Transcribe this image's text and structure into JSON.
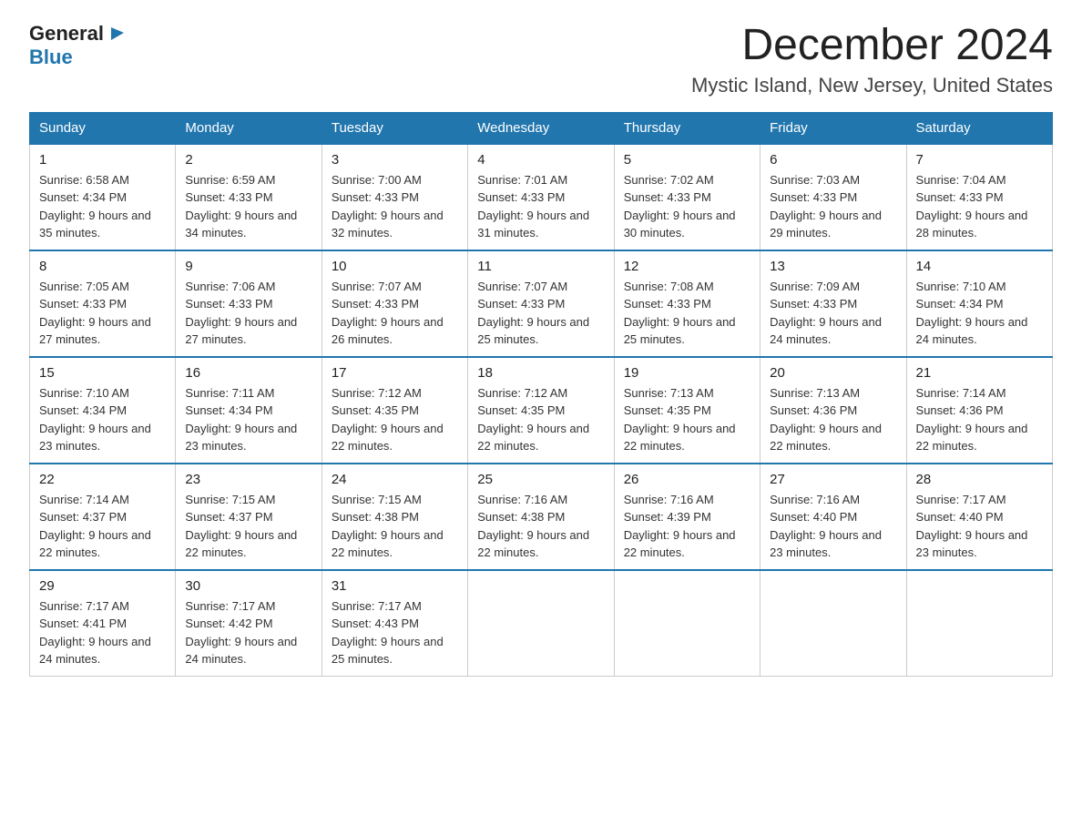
{
  "logo": {
    "general": "General",
    "blue": "Blue"
  },
  "title": "December 2024",
  "subtitle": "Mystic Island, New Jersey, United States",
  "days_of_week": [
    "Sunday",
    "Monday",
    "Tuesday",
    "Wednesday",
    "Thursday",
    "Friday",
    "Saturday"
  ],
  "weeks": [
    [
      {
        "day": "1",
        "sunrise": "6:58 AM",
        "sunset": "4:34 PM",
        "daylight": "9 hours and 35 minutes."
      },
      {
        "day": "2",
        "sunrise": "6:59 AM",
        "sunset": "4:33 PM",
        "daylight": "9 hours and 34 minutes."
      },
      {
        "day": "3",
        "sunrise": "7:00 AM",
        "sunset": "4:33 PM",
        "daylight": "9 hours and 32 minutes."
      },
      {
        "day": "4",
        "sunrise": "7:01 AM",
        "sunset": "4:33 PM",
        "daylight": "9 hours and 31 minutes."
      },
      {
        "day": "5",
        "sunrise": "7:02 AM",
        "sunset": "4:33 PM",
        "daylight": "9 hours and 30 minutes."
      },
      {
        "day": "6",
        "sunrise": "7:03 AM",
        "sunset": "4:33 PM",
        "daylight": "9 hours and 29 minutes."
      },
      {
        "day": "7",
        "sunrise": "7:04 AM",
        "sunset": "4:33 PM",
        "daylight": "9 hours and 28 minutes."
      }
    ],
    [
      {
        "day": "8",
        "sunrise": "7:05 AM",
        "sunset": "4:33 PM",
        "daylight": "9 hours and 27 minutes."
      },
      {
        "day": "9",
        "sunrise": "7:06 AM",
        "sunset": "4:33 PM",
        "daylight": "9 hours and 27 minutes."
      },
      {
        "day": "10",
        "sunrise": "7:07 AM",
        "sunset": "4:33 PM",
        "daylight": "9 hours and 26 minutes."
      },
      {
        "day": "11",
        "sunrise": "7:07 AM",
        "sunset": "4:33 PM",
        "daylight": "9 hours and 25 minutes."
      },
      {
        "day": "12",
        "sunrise": "7:08 AM",
        "sunset": "4:33 PM",
        "daylight": "9 hours and 25 minutes."
      },
      {
        "day": "13",
        "sunrise": "7:09 AM",
        "sunset": "4:33 PM",
        "daylight": "9 hours and 24 minutes."
      },
      {
        "day": "14",
        "sunrise": "7:10 AM",
        "sunset": "4:34 PM",
        "daylight": "9 hours and 24 minutes."
      }
    ],
    [
      {
        "day": "15",
        "sunrise": "7:10 AM",
        "sunset": "4:34 PM",
        "daylight": "9 hours and 23 minutes."
      },
      {
        "day": "16",
        "sunrise": "7:11 AM",
        "sunset": "4:34 PM",
        "daylight": "9 hours and 23 minutes."
      },
      {
        "day": "17",
        "sunrise": "7:12 AM",
        "sunset": "4:35 PM",
        "daylight": "9 hours and 22 minutes."
      },
      {
        "day": "18",
        "sunrise": "7:12 AM",
        "sunset": "4:35 PM",
        "daylight": "9 hours and 22 minutes."
      },
      {
        "day": "19",
        "sunrise": "7:13 AM",
        "sunset": "4:35 PM",
        "daylight": "9 hours and 22 minutes."
      },
      {
        "day": "20",
        "sunrise": "7:13 AM",
        "sunset": "4:36 PM",
        "daylight": "9 hours and 22 minutes."
      },
      {
        "day": "21",
        "sunrise": "7:14 AM",
        "sunset": "4:36 PM",
        "daylight": "9 hours and 22 minutes."
      }
    ],
    [
      {
        "day": "22",
        "sunrise": "7:14 AM",
        "sunset": "4:37 PM",
        "daylight": "9 hours and 22 minutes."
      },
      {
        "day": "23",
        "sunrise": "7:15 AM",
        "sunset": "4:37 PM",
        "daylight": "9 hours and 22 minutes."
      },
      {
        "day": "24",
        "sunrise": "7:15 AM",
        "sunset": "4:38 PM",
        "daylight": "9 hours and 22 minutes."
      },
      {
        "day": "25",
        "sunrise": "7:16 AM",
        "sunset": "4:38 PM",
        "daylight": "9 hours and 22 minutes."
      },
      {
        "day": "26",
        "sunrise": "7:16 AM",
        "sunset": "4:39 PM",
        "daylight": "9 hours and 22 minutes."
      },
      {
        "day": "27",
        "sunrise": "7:16 AM",
        "sunset": "4:40 PM",
        "daylight": "9 hours and 23 minutes."
      },
      {
        "day": "28",
        "sunrise": "7:17 AM",
        "sunset": "4:40 PM",
        "daylight": "9 hours and 23 minutes."
      }
    ],
    [
      {
        "day": "29",
        "sunrise": "7:17 AM",
        "sunset": "4:41 PM",
        "daylight": "9 hours and 24 minutes."
      },
      {
        "day": "30",
        "sunrise": "7:17 AM",
        "sunset": "4:42 PM",
        "daylight": "9 hours and 24 minutes."
      },
      {
        "day": "31",
        "sunrise": "7:17 AM",
        "sunset": "4:43 PM",
        "daylight": "9 hours and 25 minutes."
      },
      null,
      null,
      null,
      null
    ]
  ]
}
